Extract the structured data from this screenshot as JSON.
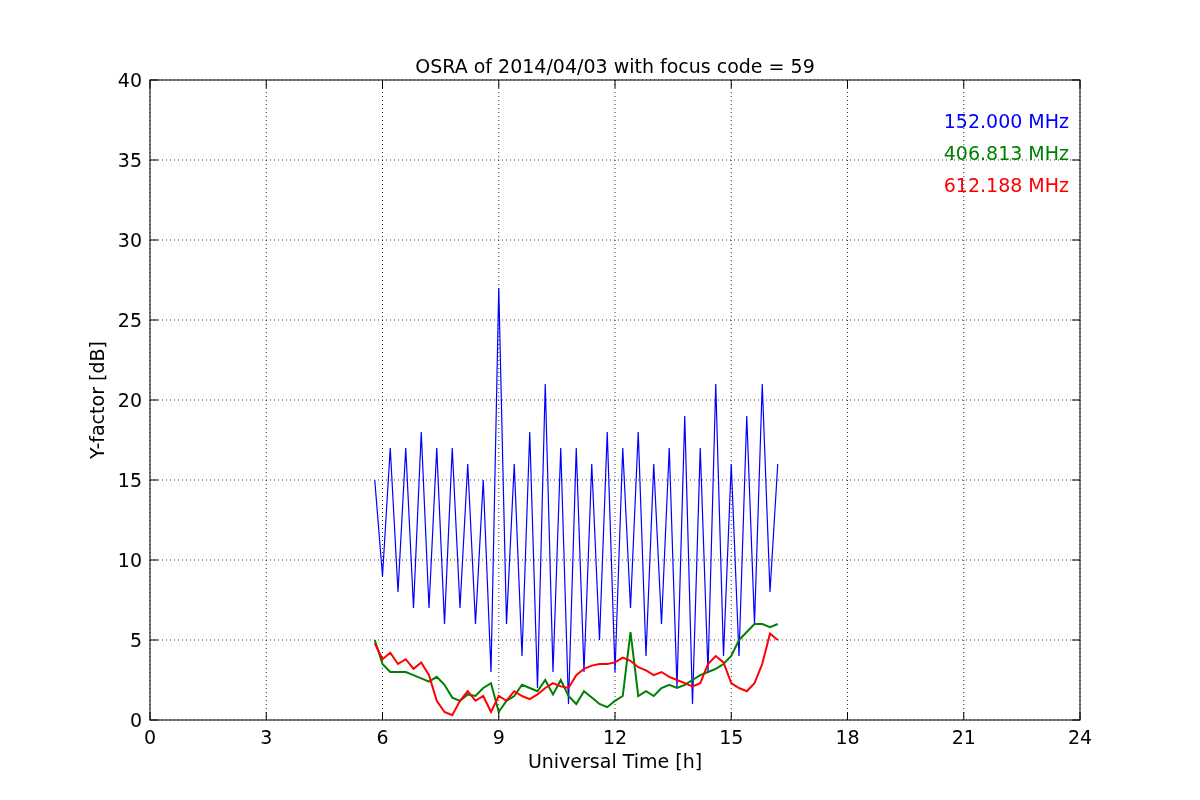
{
  "chart": {
    "chart_data": {
      "type": "line",
      "grid": true,
      "title": "OSRA of 2014/04/03 with focus code = 59",
      "xlabel": "Universal Time [h]",
      "ylabel": "Y-factor [dB]",
      "xlim": [
        0,
        24
      ],
      "ylim": [
        0,
        40
      ],
      "xticks": [
        0,
        3,
        6,
        9,
        12,
        15,
        18,
        21,
        24
      ],
      "yticks": [
        0,
        5,
        10,
        15,
        20,
        25,
        30,
        35,
        40
      ],
      "x": [
        5.8,
        6.0,
        6.2,
        6.4,
        6.6,
        6.8,
        7.0,
        7.2,
        7.4,
        7.6,
        7.8,
        8.0,
        8.2,
        8.4,
        8.6,
        8.8,
        9.0,
        9.2,
        9.4,
        9.6,
        9.8,
        10.0,
        10.2,
        10.4,
        10.6,
        10.8,
        11.0,
        11.2,
        11.4,
        11.6,
        11.8,
        12.0,
        12.2,
        12.4,
        12.6,
        12.8,
        13.0,
        13.2,
        13.4,
        13.6,
        13.8,
        14.0,
        14.2,
        14.4,
        14.6,
        14.8,
        15.0,
        15.2,
        15.4,
        15.6,
        15.8,
        16.0,
        16.2
      ],
      "series": [
        {
          "name": "152.000 MHz",
          "color": "#0000ff",
          "values": [
            15,
            9,
            17,
            8,
            17,
            7,
            18,
            7,
            17,
            6,
            17,
            7,
            16,
            6,
            15,
            3,
            27,
            6,
            16,
            4,
            18,
            2,
            21,
            3,
            17,
            1,
            17,
            3,
            16,
            5,
            18,
            3,
            17,
            7,
            18,
            4,
            16,
            6,
            17,
            2,
            19,
            1,
            17,
            3,
            21,
            4,
            16,
            4,
            19,
            6,
            21,
            8,
            16
          ]
        },
        {
          "name": "406.813 MHz",
          "color": "#008000",
          "values": [
            5,
            3.5,
            3,
            3,
            3,
            2.8,
            2.6,
            2.4,
            2.7,
            2.2,
            1.4,
            1.2,
            1.6,
            1.5,
            2,
            2.3,
            0.5,
            1.2,
            1.5,
            2.2,
            2,
            1.8,
            2.5,
            1.6,
            2.5,
            1.5,
            1,
            1.8,
            1.4,
            1,
            0.8,
            1.2,
            1.5,
            5.5,
            1.5,
            1.8,
            1.5,
            2,
            2.2,
            2,
            2.2,
            2.5,
            2.8,
            3,
            3.2,
            3.5,
            4,
            5,
            5.5,
            6,
            6,
            5.8,
            6
          ]
        },
        {
          "name": "612.188 MHz",
          "color": "#ff0000",
          "values": [
            4.8,
            3.8,
            4.2,
            3.5,
            3.8,
            3.2,
            3.6,
            2.8,
            1.2,
            0.5,
            0.3,
            1.2,
            1.8,
            1.2,
            1.5,
            0.5,
            1.5,
            1.2,
            1.8,
            1.5,
            1.3,
            1.6,
            2,
            2.3,
            2.1,
            2,
            2.8,
            3.2,
            3.4,
            3.5,
            3.5,
            3.6,
            3.9,
            3.7,
            3.3,
            3.1,
            2.8,
            3,
            2.7,
            2.5,
            2.3,
            2.1,
            2.3,
            3.5,
            4,
            3.6,
            2.3,
            2,
            1.8,
            2.3,
            3.5,
            5.4,
            5
          ]
        }
      ]
    }
  }
}
